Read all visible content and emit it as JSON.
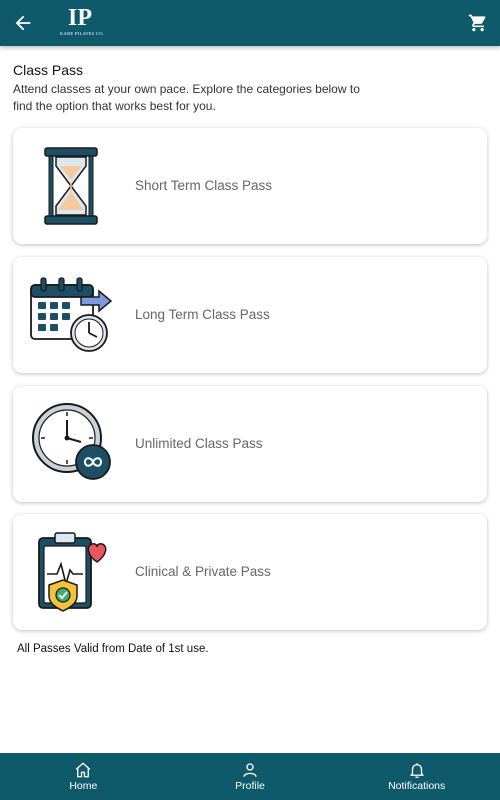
{
  "app": {
    "theme_color": "#0e5a6b"
  },
  "header": {
    "logo_mark": "IP",
    "logo_text": "KARE PILATES CO.",
    "back_icon": "arrow-left-icon",
    "cart_icon": "cart-icon"
  },
  "page": {
    "title": "Class Pass",
    "subtitle": "Attend classes at your own pace. Explore the categories below to find the option that works best for you."
  },
  "passes": [
    {
      "label": "Short Term Class Pass",
      "icon": "hourglass-icon"
    },
    {
      "label": "Long Term Class Pass",
      "icon": "calendar-clock-icon"
    },
    {
      "label": "Unlimited Class Pass",
      "icon": "clock-infinity-icon"
    },
    {
      "label": "Clinical & Private Pass",
      "icon": "clipboard-heart-shield-icon"
    }
  ],
  "footer_note": "All Passes Valid from Date of 1st use.",
  "bottom_nav": [
    {
      "label": "Home",
      "icon": "home-icon"
    },
    {
      "label": "Profile",
      "icon": "profile-icon"
    },
    {
      "label": "Notifications",
      "icon": "bell-icon"
    }
  ]
}
